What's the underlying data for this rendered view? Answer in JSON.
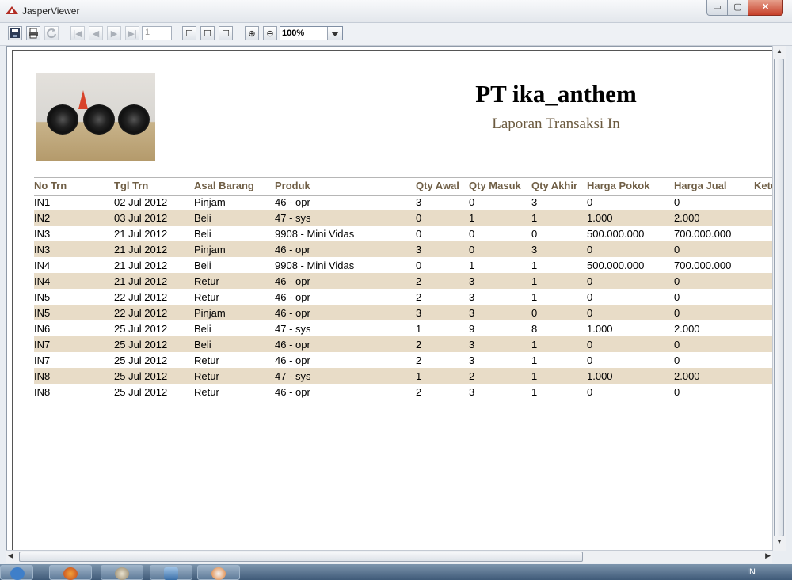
{
  "window": {
    "title": "JasperViewer",
    "min_label": "▭",
    "max_label": "▢",
    "close_label": "✕"
  },
  "toolbar": {
    "save_icon": "save-icon",
    "print_icon": "print-icon",
    "reload_icon": "reload-icon",
    "first_label": "|◀",
    "prev_label": "◀",
    "next_label": "▶",
    "last_label": "▶|",
    "page_value": "1",
    "fit_actual_label": "☐",
    "fit_page_label": "☐",
    "fit_width_label": "☐",
    "zoom_in_label": "⊕",
    "zoom_out_label": "⊖",
    "zoom_value": "100%"
  },
  "report": {
    "company": "PT ika_anthem",
    "subtitle": "Laporan Transaksi In",
    "columns": [
      "No Trn",
      "Tgl Trn",
      "Asal Barang",
      "Produk",
      "Qty Awal",
      "Qty Masuk",
      "Qty Akhir",
      "Harga Pokok",
      "Harga Jual",
      "Kete"
    ],
    "rows": [
      [
        "IN1",
        "02 Jul 2012",
        "Pinjam",
        "46 - opr",
        "3",
        "0",
        "3",
        "0",
        "0"
      ],
      [
        "IN2",
        "03 Jul 2012",
        "Beli",
        "47 - sys",
        "0",
        "1",
        "1",
        "1.000",
        "2.000"
      ],
      [
        "IN3",
        "21 Jul 2012",
        "Beli",
        "9908 - Mini Vidas",
        "0",
        "0",
        "0",
        "500.000.000",
        "700.000.000"
      ],
      [
        "IN3",
        "21 Jul 2012",
        "Pinjam",
        "46 - opr",
        "3",
        "0",
        "3",
        "0",
        "0"
      ],
      [
        "IN4",
        "21 Jul 2012",
        "Beli",
        "9908 - Mini Vidas",
        "0",
        "1",
        "1",
        "500.000.000",
        "700.000.000"
      ],
      [
        "IN4",
        "21 Jul 2012",
        "Retur",
        "46 - opr",
        "2",
        "3",
        "1",
        "0",
        "0"
      ],
      [
        "IN5",
        "22 Jul 2012",
        "Retur",
        "46 - opr",
        "2",
        "3",
        "1",
        "0",
        "0"
      ],
      [
        "IN5",
        "22 Jul 2012",
        "Pinjam",
        "46 - opr",
        "3",
        "3",
        "0",
        "0",
        "0"
      ],
      [
        "IN6",
        "25 Jul 2012",
        "Beli",
        "47 - sys",
        "1",
        "9",
        "8",
        "1.000",
        "2.000"
      ],
      [
        "IN7",
        "25 Jul 2012",
        "Beli",
        "46 - opr",
        "2",
        "3",
        "1",
        "0",
        "0"
      ],
      [
        "IN7",
        "25 Jul 2012",
        "Retur",
        "46 - opr",
        "2",
        "3",
        "1",
        "0",
        "0"
      ],
      [
        "IN8",
        "25 Jul 2012",
        "Retur",
        "47 - sys",
        "1",
        "2",
        "1",
        "1.000",
        "2.000"
      ],
      [
        "IN8",
        "25 Jul 2012",
        "Retur",
        "46 - opr",
        "2",
        "3",
        "1",
        "0",
        "0"
      ]
    ]
  },
  "taskbar": {
    "language": "IN"
  }
}
